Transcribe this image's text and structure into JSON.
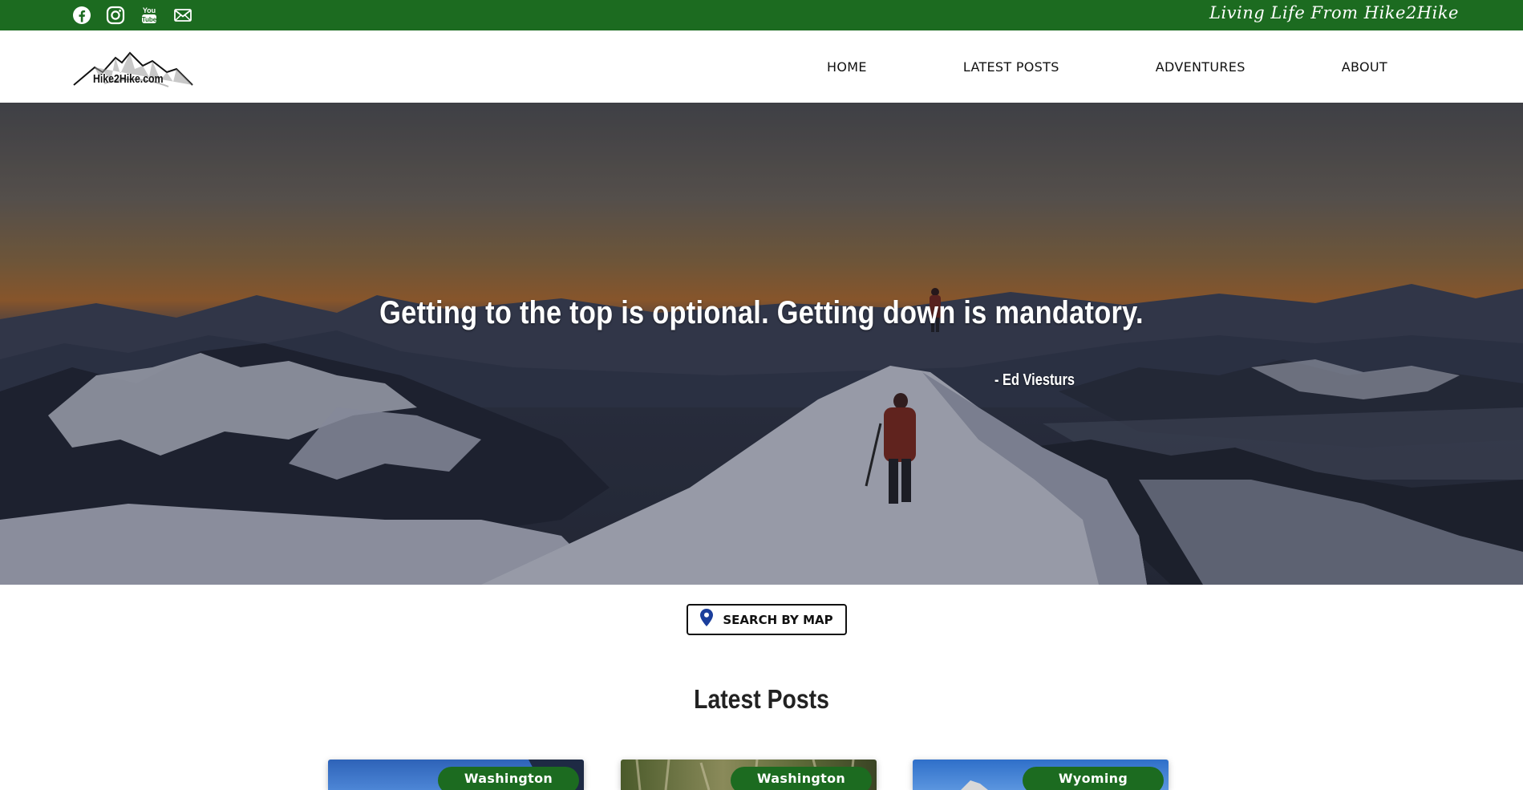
{
  "topbar": {
    "tagline": "Living Life From Hike2Hike",
    "social": [
      "facebook-icon",
      "instagram-icon",
      "youtube-icon",
      "email-icon"
    ],
    "color": "#1c6b20"
  },
  "header": {
    "logo_text": "Hike2Hike.com",
    "nav": [
      "HOME",
      "LATEST POSTS",
      "ADVENTURES",
      "ABOUT"
    ]
  },
  "hero": {
    "quote": "Getting to the top is optional. Getting down is mandatory.",
    "author": "- Ed Viesturs"
  },
  "search": {
    "label": "SEARCH BY MAP",
    "icon": "map-pin-icon",
    "pin_color": "#1a3e9c"
  },
  "latest": {
    "title": "Latest Posts",
    "cards": [
      {
        "badge": "Washington"
      },
      {
        "badge": "Washington"
      },
      {
        "badge": "Wyoming"
      }
    ]
  }
}
